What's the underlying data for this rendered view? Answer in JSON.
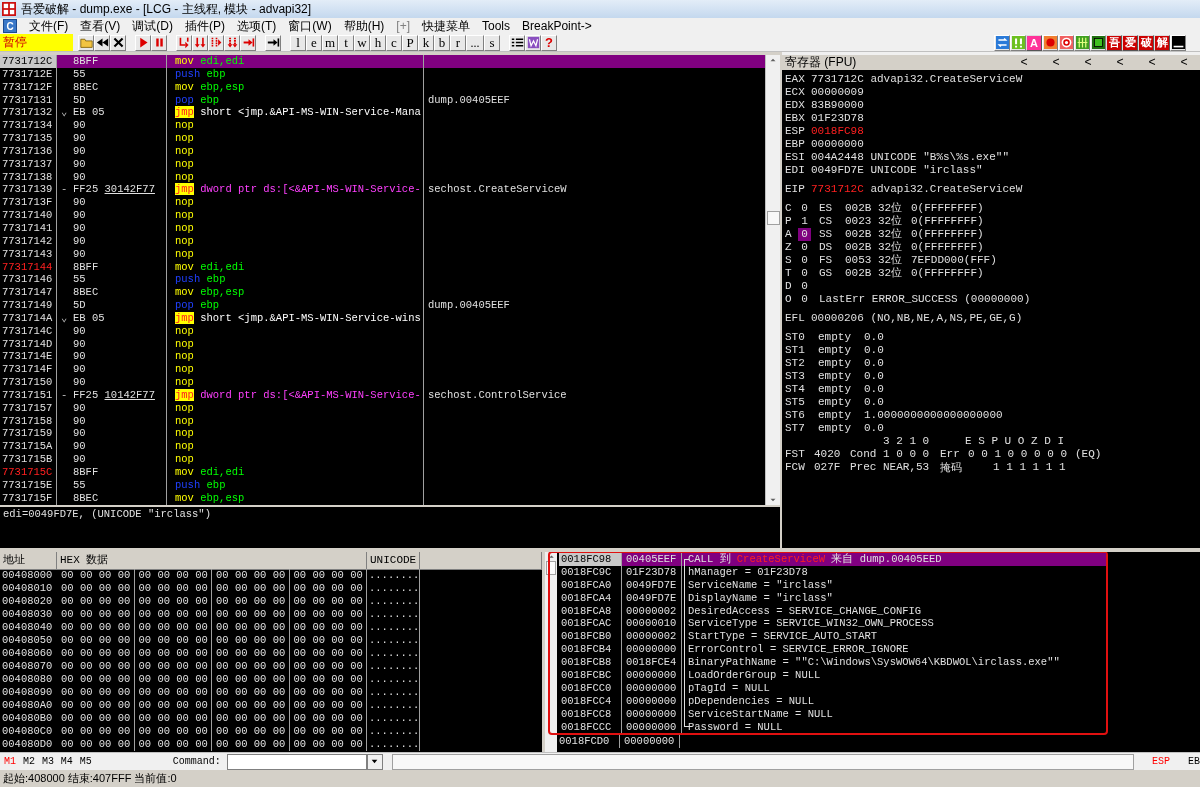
{
  "window": {
    "title": "吾爱破解 - dump.exe - [LCG - 主线程, 模块 - advapi32]"
  },
  "menu": {
    "app_label": "C",
    "items": [
      {
        "label": "文件(F)",
        "disabled": false
      },
      {
        "label": "查看(V)",
        "disabled": false
      },
      {
        "label": "调试(D)",
        "disabled": false
      },
      {
        "label": "插件(P)",
        "disabled": false
      },
      {
        "label": "选项(T)",
        "disabled": false
      },
      {
        "label": "窗口(W)",
        "disabled": false
      },
      {
        "label": "帮助(H)",
        "disabled": false
      },
      {
        "label": "[+]",
        "disabled": true
      },
      {
        "label": "快捷菜单",
        "disabled": false
      },
      {
        "label": "Tools",
        "disabled": false
      },
      {
        "label": "BreakPoint->",
        "disabled": false
      }
    ]
  },
  "toolbar": {
    "status": "暂停",
    "groups": [
      [
        {
          "kind": "open"
        },
        {
          "kind": "rewind"
        },
        {
          "kind": "close"
        }
      ],
      [
        {
          "kind": "run"
        },
        {
          "kind": "pause"
        }
      ],
      [
        {
          "kind": "step-in"
        },
        {
          "kind": "step-over"
        },
        {
          "kind": "trace-in"
        },
        {
          "kind": "trace-over"
        },
        {
          "kind": "till-return"
        }
      ],
      [
        {
          "kind": "goto"
        }
      ],
      [
        {
          "kind": "letter",
          "label": "l"
        },
        {
          "kind": "letter",
          "label": "e"
        },
        {
          "kind": "letter",
          "label": "m"
        },
        {
          "kind": "letter",
          "label": "t"
        },
        {
          "kind": "letter",
          "label": "w"
        },
        {
          "kind": "letter",
          "label": "h"
        },
        {
          "kind": "letter",
          "label": "c"
        },
        {
          "kind": "letter",
          "label": "P"
        },
        {
          "kind": "letter",
          "label": "k"
        },
        {
          "kind": "letter",
          "label": "b"
        },
        {
          "kind": "letter",
          "label": "r"
        },
        {
          "kind": "letter",
          "label": "..."
        },
        {
          "kind": "letter",
          "label": "s"
        }
      ],
      [
        {
          "kind": "list"
        },
        {
          "kind": "window"
        },
        {
          "kind": "help",
          "label": "?"
        }
      ]
    ],
    "tools": [
      {
        "kind": "swap"
      },
      {
        "kind": "pair"
      },
      {
        "kind": "tile",
        "label": "A",
        "color": "#ff3399"
      },
      {
        "kind": "dot"
      },
      {
        "kind": "target"
      },
      {
        "kind": "grid"
      },
      {
        "kind": "square"
      },
      {
        "kind": "tile",
        "label": "吾",
        "color": "#cc0000"
      },
      {
        "kind": "tile",
        "label": "爱",
        "color": "#cc0000"
      },
      {
        "kind": "tile",
        "label": "破",
        "color": "#cc0000"
      },
      {
        "kind": "tile",
        "label": "解",
        "color": "#cc0000"
      },
      {
        "kind": "bar"
      }
    ]
  },
  "disasm": {
    "rows": [
      {
        "address": "7731712C",
        "hex": "8BFF",
        "kind": "mov",
        "mnemonic": "mov",
        "operands": "edi,edi",
        "selected": true,
        "breakpoint": false
      },
      {
        "address": "7731712E",
        "hex": "55",
        "kind": "stack",
        "mnemonic": "push",
        "operands": "ebp",
        "selected": false,
        "breakpoint": false
      },
      {
        "address": "7731712F",
        "hex": "8BEC",
        "kind": "mov",
        "mnemonic": "mov",
        "operands": "ebp,esp",
        "selected": false,
        "breakpoint": false
      },
      {
        "address": "77317131",
        "hex": "5D",
        "kind": "stack",
        "mnemonic": "pop",
        "operands": "ebp",
        "comment": "dump.00405EEF",
        "selected": false,
        "breakpoint": false
      },
      {
        "address": "77317132",
        "jump_mark": "⌄",
        "hex": "EB 05",
        "kind": "jump",
        "mnemonic": "jmp",
        "operands": "short <jmp.&API-MS-WIN-Service-Mana",
        "selected": false,
        "breakpoint": false
      },
      {
        "address": "77317134",
        "hex": "90",
        "kind": "nop",
        "mnemonic": "nop",
        "selected": false,
        "breakpoint": false
      },
      {
        "address": "77317135",
        "hex": "90",
        "kind": "nop",
        "mnemonic": "nop",
        "selected": false,
        "breakpoint": false
      },
      {
        "address": "77317136",
        "hex": "90",
        "kind": "nop",
        "mnemonic": "nop",
        "selected": false,
        "breakpoint": false
      },
      {
        "address": "77317137",
        "hex": "90",
        "kind": "nop",
        "mnemonic": "nop",
        "selected": false,
        "breakpoint": false
      },
      {
        "address": "77317138",
        "hex": "90",
        "kind": "nop",
        "mnemonic": "nop",
        "selected": false,
        "breakpoint": false
      },
      {
        "address": "77317139",
        "jump_mark": "-",
        "hex": "FF25",
        "hex_operand": "30142F77",
        "kind": "jump_indirect",
        "mnemonic": "jmp",
        "operands": "dword ptr ds:[<&API-MS-WIN-Service-",
        "comment": "sechost.CreateServiceW",
        "selected": false,
        "breakpoint": false
      },
      {
        "address": "7731713F",
        "hex": "90",
        "kind": "nop",
        "mnemonic": "nop",
        "selected": false,
        "breakpoint": false
      },
      {
        "address": "77317140",
        "hex": "90",
        "kind": "nop",
        "mnemonic": "nop",
        "selected": false,
        "breakpoint": false
      },
      {
        "address": "77317141",
        "hex": "90",
        "kind": "nop",
        "mnemonic": "nop",
        "selected": false,
        "breakpoint": false
      },
      {
        "address": "77317142",
        "hex": "90",
        "kind": "nop",
        "mnemonic": "nop",
        "selected": false,
        "breakpoint": false
      },
      {
        "address": "77317143",
        "hex": "90",
        "kind": "nop",
        "mnemonic": "nop",
        "selected": false,
        "breakpoint": false
      },
      {
        "address": "77317144",
        "hex": "8BFF",
        "kind": "mov",
        "mnemonic": "mov",
        "operands": "edi,edi",
        "selected": false,
        "breakpoint": true
      },
      {
        "address": "77317146",
        "hex": "55",
        "kind": "stack",
        "mnemonic": "push",
        "operands": "ebp",
        "selected": false,
        "breakpoint": false
      },
      {
        "address": "77317147",
        "hex": "8BEC",
        "kind": "mov",
        "mnemonic": "mov",
        "operands": "ebp,esp",
        "selected": false,
        "breakpoint": false
      },
      {
        "address": "77317149",
        "hex": "5D",
        "kind": "stack",
        "mnemonic": "pop",
        "operands": "ebp",
        "comment": "dump.00405EEF",
        "selected": false,
        "breakpoint": false
      },
      {
        "address": "7731714A",
        "jump_mark": "⌄",
        "hex": "EB 05",
        "kind": "jump",
        "mnemonic": "jmp",
        "operands": "short <jmp.&API-MS-WIN-Service-wins",
        "selected": false,
        "breakpoint": false
      },
      {
        "address": "7731714C",
        "hex": "90",
        "kind": "nop",
        "mnemonic": "nop",
        "selected": false,
        "breakpoint": false
      },
      {
        "address": "7731714D",
        "hex": "90",
        "kind": "nop",
        "mnemonic": "nop",
        "selected": false,
        "breakpoint": false
      },
      {
        "address": "7731714E",
        "hex": "90",
        "kind": "nop",
        "mnemonic": "nop",
        "selected": false,
        "breakpoint": false
      },
      {
        "address": "7731714F",
        "hex": "90",
        "kind": "nop",
        "mnemonic": "nop",
        "selected": false,
        "breakpoint": false
      },
      {
        "address": "77317150",
        "hex": "90",
        "kind": "nop",
        "mnemonic": "nop",
        "selected": false,
        "breakpoint": false
      },
      {
        "address": "77317151",
        "jump_mark": "-",
        "hex": "FF25",
        "hex_operand": "10142F77",
        "kind": "jump_indirect",
        "mnemonic": "jmp",
        "operands": "dword ptr ds:[<&API-MS-WIN-Service-",
        "comment": "sechost.ControlService",
        "selected": false,
        "breakpoint": false
      },
      {
        "address": "77317157",
        "hex": "90",
        "kind": "nop",
        "mnemonic": "nop",
        "selected": false,
        "breakpoint": false
      },
      {
        "address": "77317158",
        "hex": "90",
        "kind": "nop",
        "mnemonic": "nop",
        "selected": false,
        "breakpoint": false
      },
      {
        "address": "77317159",
        "hex": "90",
        "kind": "nop",
        "mnemonic": "nop",
        "selected": false,
        "breakpoint": false
      },
      {
        "address": "7731715A",
        "hex": "90",
        "kind": "nop",
        "mnemonic": "nop",
        "selected": false,
        "breakpoint": false
      },
      {
        "address": "7731715B",
        "hex": "90",
        "kind": "nop",
        "mnemonic": "nop",
        "selected": false,
        "breakpoint": false
      },
      {
        "address": "7731715C",
        "hex": "8BFF",
        "kind": "mov",
        "mnemonic": "mov",
        "operands": "edi,edi",
        "selected": false,
        "breakpoint": true
      },
      {
        "address": "7731715E",
        "hex": "55",
        "kind": "stack",
        "mnemonic": "push",
        "operands": "ebp",
        "selected": false,
        "breakpoint": false
      },
      {
        "address": "7731715F",
        "hex": "8BEC",
        "kind": "mov",
        "mnemonic": "mov",
        "operands": "ebp,esp",
        "selected": false,
        "breakpoint": false
      }
    ],
    "info": "edi=0049FD7E, (UNICODE \"irclass\")"
  },
  "registers": {
    "title": "寄存器 (FPU)",
    "nav_buttons": [
      "<",
      "<",
      "<",
      "<",
      "<",
      "<"
    ],
    "general": [
      {
        "name": "EAX",
        "value": "7731712C",
        "comment": "advapi32.CreateServiceW",
        "changed": false
      },
      {
        "name": "ECX",
        "value": "00000009",
        "changed": false
      },
      {
        "name": "EDX",
        "value": "83B90000",
        "changed": false
      },
      {
        "name": "EBX",
        "value": "01F23D78",
        "changed": false
      },
      {
        "name": "ESP",
        "value": "0018FC98",
        "changed": true
      },
      {
        "name": "EBP",
        "value": "00000000",
        "changed": false
      },
      {
        "name": "ESI",
        "value": "004A2448",
        "comment": "UNICODE \"B%s\\%s.exe\"\"",
        "changed": false
      },
      {
        "name": "EDI",
        "value": "0049FD7E",
        "comment": "UNICODE \"irclass\"",
        "changed": false
      }
    ],
    "eip": {
      "name": "EIP",
      "value": "7731712C",
      "comment": "advapi32.CreateServiceW",
      "changed": true
    },
    "flags": [
      {
        "name": "C",
        "value": "0",
        "selected": false
      },
      {
        "name": "P",
        "value": "1",
        "selected": false
      },
      {
        "name": "A",
        "value": "0",
        "selected": true
      },
      {
        "name": "Z",
        "value": "0",
        "selected": false
      },
      {
        "name": "S",
        "value": "0",
        "selected": false
      },
      {
        "name": "T",
        "value": "0",
        "selected": false
      },
      {
        "name": "D",
        "value": "0",
        "selected": false
      },
      {
        "name": "O",
        "value": "0",
        "selected": false
      }
    ],
    "segments": [
      {
        "name": "ES",
        "selector": "002B",
        "bits": "32位",
        "base": "0(FFFFFFFF)"
      },
      {
        "name": "CS",
        "selector": "0023",
        "bits": "32位",
        "base": "0(FFFFFFFF)"
      },
      {
        "name": "SS",
        "selector": "002B",
        "bits": "32位",
        "base": "0(FFFFFFFF)"
      },
      {
        "name": "DS",
        "selector": "002B",
        "bits": "32位",
        "base": "0(FFFFFFFF)"
      },
      {
        "name": "FS",
        "selector": "0053",
        "bits": "32位",
        "base": "7EFDD000(FFF)"
      },
      {
        "name": "GS",
        "selector": "002B",
        "bits": "32位",
        "base": "0(FFFFFFFF)"
      }
    ],
    "last_error": {
      "label": "LastErr",
      "value": "ERROR_SUCCESS (00000000)"
    },
    "efl": {
      "name": "EFL",
      "value": "00000206",
      "decoded": "(NO,NB,NE,A,NS,PE,GE,G)"
    },
    "fpu_stack": [
      {
        "name": "ST0",
        "tag": "empty",
        "value": "0.0"
      },
      {
        "name": "ST1",
        "tag": "empty",
        "value": "0.0"
      },
      {
        "name": "ST2",
        "tag": "empty",
        "value": "0.0"
      },
      {
        "name": "ST3",
        "tag": "empty",
        "value": "0.0"
      },
      {
        "name": "ST4",
        "tag": "empty",
        "value": "0.0"
      },
      {
        "name": "ST5",
        "tag": "empty",
        "value": "0.0"
      },
      {
        "name": "ST6",
        "tag": "empty",
        "value": "1.0000000000000000000"
      },
      {
        "name": "ST7",
        "tag": "empty",
        "value": "0.0"
      }
    ],
    "fpu_status": {
      "cond_header": "3 2 1 0",
      "err_header": "E S P U O Z D I",
      "fst": {
        "name": "FST",
        "value": "4020",
        "cond_label": "Cond",
        "cond": "1 0 0 0",
        "err_label": "Err",
        "err": "0 0 1 0 0 0 0 0",
        "result": "(EQ)"
      },
      "fcw": {
        "name": "FCW",
        "value": "027F",
        "prec_label": "Prec",
        "prec": "NEAR,53",
        "mask_label": "掩码",
        "mask": "1 1 1 1 1 1"
      }
    }
  },
  "dump": {
    "columns": [
      "地址",
      "HEX 数据",
      "UNICODE"
    ],
    "rows": [
      {
        "address": "00408000",
        "hex": [
          "00 00 00 00",
          "00 00 00 00",
          "00 00 00 00",
          "00 00 00 00"
        ],
        "text": "........"
      },
      {
        "address": "00408010",
        "hex": [
          "00 00 00 00",
          "00 00 00 00",
          "00 00 00 00",
          "00 00 00 00"
        ],
        "text": "........"
      },
      {
        "address": "00408020",
        "hex": [
          "00 00 00 00",
          "00 00 00 00",
          "00 00 00 00",
          "00 00 00 00"
        ],
        "text": "........"
      },
      {
        "address": "00408030",
        "hex": [
          "00 00 00 00",
          "00 00 00 00",
          "00 00 00 00",
          "00 00 00 00"
        ],
        "text": "........"
      },
      {
        "address": "00408040",
        "hex": [
          "00 00 00 00",
          "00 00 00 00",
          "00 00 00 00",
          "00 00 00 00"
        ],
        "text": "........"
      },
      {
        "address": "00408050",
        "hex": [
          "00 00 00 00",
          "00 00 00 00",
          "00 00 00 00",
          "00 00 00 00"
        ],
        "text": "........"
      },
      {
        "address": "00408060",
        "hex": [
          "00 00 00 00",
          "00 00 00 00",
          "00 00 00 00",
          "00 00 00 00"
        ],
        "text": "........"
      },
      {
        "address": "00408070",
        "hex": [
          "00 00 00 00",
          "00 00 00 00",
          "00 00 00 00",
          "00 00 00 00"
        ],
        "text": "........"
      },
      {
        "address": "00408080",
        "hex": [
          "00 00 00 00",
          "00 00 00 00",
          "00 00 00 00",
          "00 00 00 00"
        ],
        "text": "........"
      },
      {
        "address": "00408090",
        "hex": [
          "00 00 00 00",
          "00 00 00 00",
          "00 00 00 00",
          "00 00 00 00"
        ],
        "text": "........"
      },
      {
        "address": "004080A0",
        "hex": [
          "00 00 00 00",
          "00 00 00 00",
          "00 00 00 00",
          "00 00 00 00"
        ],
        "text": "........"
      },
      {
        "address": "004080B0",
        "hex": [
          "00 00 00 00",
          "00 00 00 00",
          "00 00 00 00",
          "00 00 00 00"
        ],
        "text": "........"
      },
      {
        "address": "004080C0",
        "hex": [
          "00 00 00 00",
          "00 00 00 00",
          "00 00 00 00",
          "00 00 00 00"
        ],
        "text": "........"
      },
      {
        "address": "004080D0",
        "hex": [
          "00 00 00 00",
          "00 00 00 00",
          "00 00 00 00",
          "00 00 00 00"
        ],
        "text": "........"
      }
    ]
  },
  "stack": {
    "rows": [
      {
        "address": "0018FC98",
        "value": "00405EEF",
        "comment_prefix": "CALL 到",
        "comment_target": "CreateServiceW",
        "comment_suffix": "来自 dump.00405EED",
        "in_call_frame": true,
        "selected": true,
        "highlighted": true
      },
      {
        "address": "0018FC9C",
        "value": "01F23D78",
        "comment": "hManager = 01F23D78",
        "in_call_frame": true,
        "selected": false,
        "highlighted": true
      },
      {
        "address": "0018FCA0",
        "value": "0049FD7E",
        "comment": "ServiceName = \"irclass\"",
        "in_call_frame": true,
        "selected": false,
        "highlighted": true
      },
      {
        "address": "0018FCA4",
        "value": "0049FD7E",
        "comment": "DisplayName = \"irclass\"",
        "in_call_frame": true,
        "selected": false,
        "highlighted": true
      },
      {
        "address": "0018FCA8",
        "value": "00000002",
        "comment": "DesiredAccess = SERVICE_CHANGE_CONFIG",
        "in_call_frame": true,
        "selected": false,
        "highlighted": true
      },
      {
        "address": "0018FCAC",
        "value": "00000010",
        "comment": "ServiceType = SERVICE_WIN32_OWN_PROCESS",
        "in_call_frame": true,
        "selected": false,
        "highlighted": true
      },
      {
        "address": "0018FCB0",
        "value": "00000002",
        "comment": "StartType = SERVICE_AUTO_START",
        "in_call_frame": true,
        "selected": false,
        "highlighted": true
      },
      {
        "address": "0018FCB4",
        "value": "00000000",
        "comment": "ErrorControl = SERVICE_ERROR_IGNORE",
        "in_call_frame": true,
        "selected": false,
        "highlighted": true
      },
      {
        "address": "0018FCB8",
        "value": "0018FCE4",
        "comment": "BinaryPathName = \"\"C:\\Windows\\SysWOW64\\KBDWOL\\irclass.exe\"\"",
        "in_call_frame": true,
        "selected": false,
        "highlighted": true
      },
      {
        "address": "0018FCBC",
        "value": "00000000",
        "comment": "LoadOrderGroup = NULL",
        "in_call_frame": true,
        "selected": false,
        "highlighted": true
      },
      {
        "address": "0018FCC0",
        "value": "00000000",
        "comment": "pTagId = NULL",
        "in_call_frame": true,
        "selected": false,
        "highlighted": true
      },
      {
        "address": "0018FCC4",
        "value": "00000000",
        "comment": "pDependencies = NULL",
        "in_call_frame": true,
        "selected": false,
        "highlighted": true
      },
      {
        "address": "0018FCC8",
        "value": "00000000",
        "comment": "ServiceStartName = NULL",
        "in_call_frame": true,
        "selected": false,
        "highlighted": true
      },
      {
        "address": "0018FCCC",
        "value": "00000000",
        "comment": "Password = NULL",
        "in_call_frame": true,
        "selected": false,
        "highlighted": true
      },
      {
        "address": "0018FCD0",
        "value": "00000000",
        "in_call_frame": false,
        "selected": false,
        "highlighted": false
      }
    ]
  },
  "command_bar": {
    "memory_tabs": [
      {
        "label": "M1",
        "selected": true
      },
      {
        "label": "M2",
        "selected": false
      },
      {
        "label": "M3",
        "selected": false
      },
      {
        "label": "M4",
        "selected": false
      },
      {
        "label": "M5",
        "selected": false
      }
    ],
    "command_label": "Command:",
    "registers": [
      {
        "label": "ESP",
        "selected": true
      },
      {
        "label": "EB",
        "selected": false
      }
    ]
  },
  "status_bar": "起始:408000 结束:407FFF 当前值:0"
}
